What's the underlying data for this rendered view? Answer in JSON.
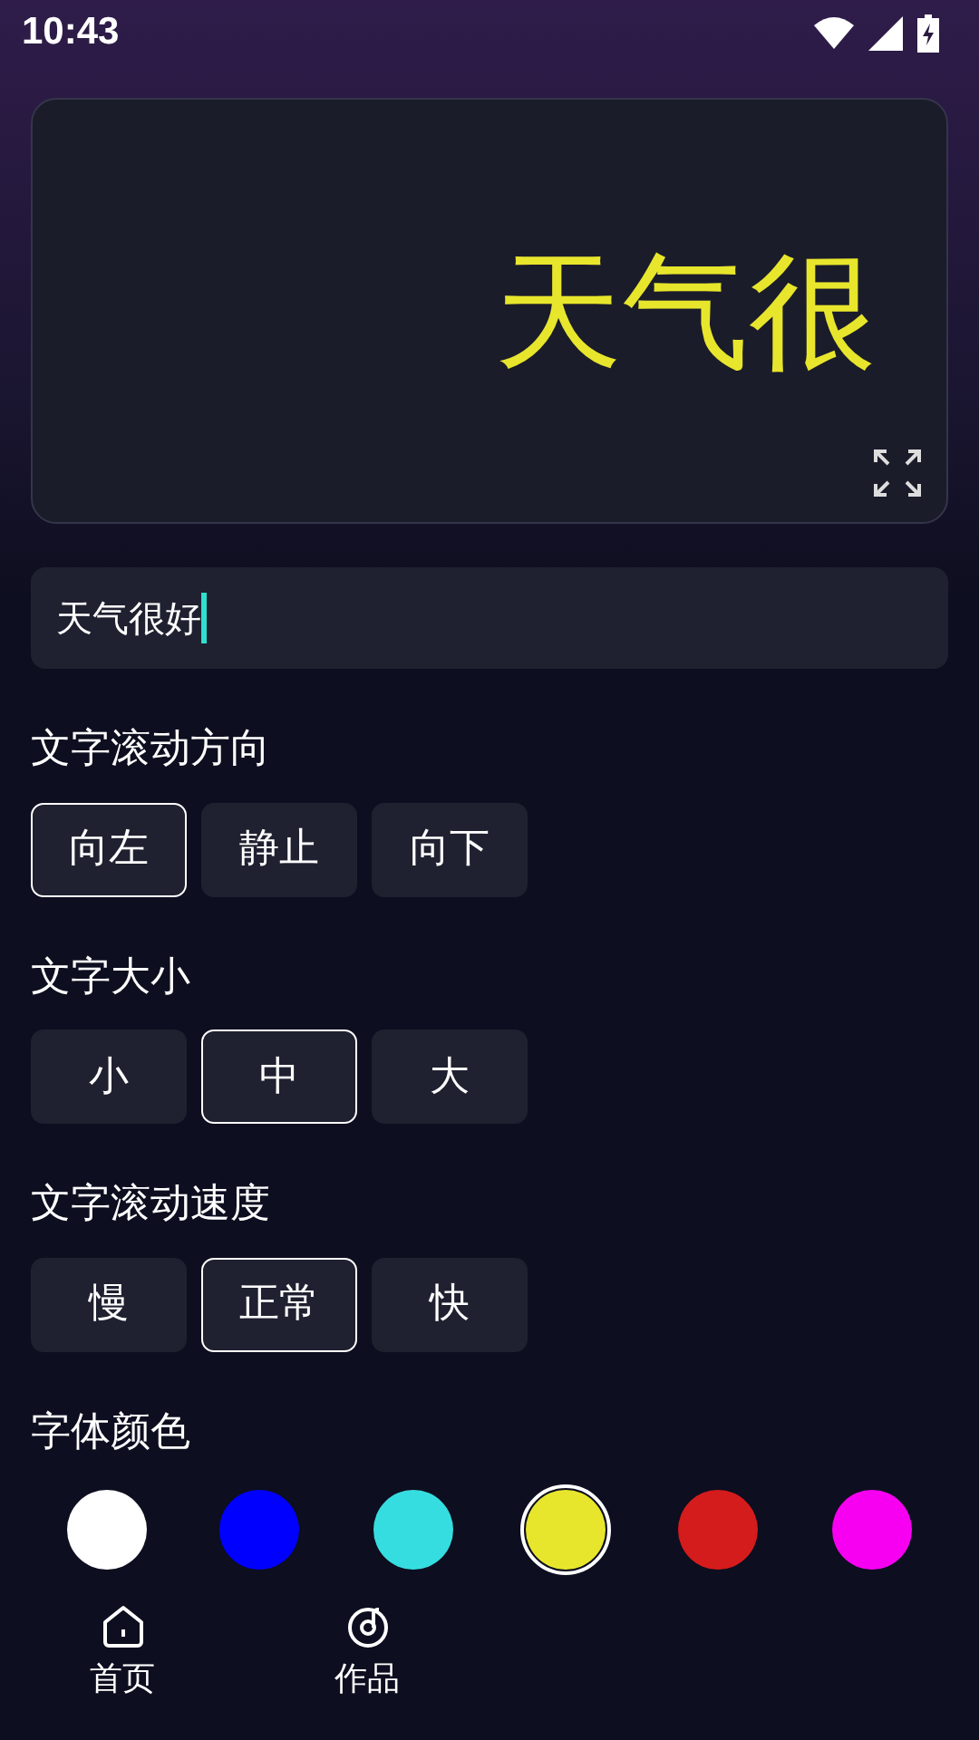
{
  "status_bar": {
    "time": "10:43"
  },
  "preview": {
    "text": "天气很",
    "color": "#e8e62c"
  },
  "text_input": {
    "value": "天气很好"
  },
  "sections": [
    {
      "title": "文字滚动方向",
      "options": [
        {
          "label": "向左",
          "selected": true
        },
        {
          "label": "静止",
          "selected": false
        },
        {
          "label": "向下",
          "selected": false
        }
      ]
    },
    {
      "title": "文字大小",
      "options": [
        {
          "label": "小",
          "selected": false
        },
        {
          "label": "中",
          "selected": true
        },
        {
          "label": "大",
          "selected": false
        }
      ]
    },
    {
      "title": "文字滚动速度",
      "options": [
        {
          "label": "慢",
          "selected": false
        },
        {
          "label": "正常",
          "selected": true
        },
        {
          "label": "快",
          "selected": false
        }
      ]
    }
  ],
  "font_color": {
    "title": "字体颜色",
    "swatches": [
      {
        "color": "#ffffff",
        "selected": false
      },
      {
        "color": "#0000ff",
        "selected": false
      },
      {
        "color": "#36dde0",
        "selected": false
      },
      {
        "color": "#e8e62c",
        "selected": true
      },
      {
        "color": "#d41c1c",
        "selected": false
      },
      {
        "color": "#f700f2",
        "selected": false
      }
    ]
  },
  "bottom_nav": [
    {
      "label": "首页",
      "kind": "home"
    },
    {
      "label": "作品",
      "kind": "works"
    }
  ]
}
